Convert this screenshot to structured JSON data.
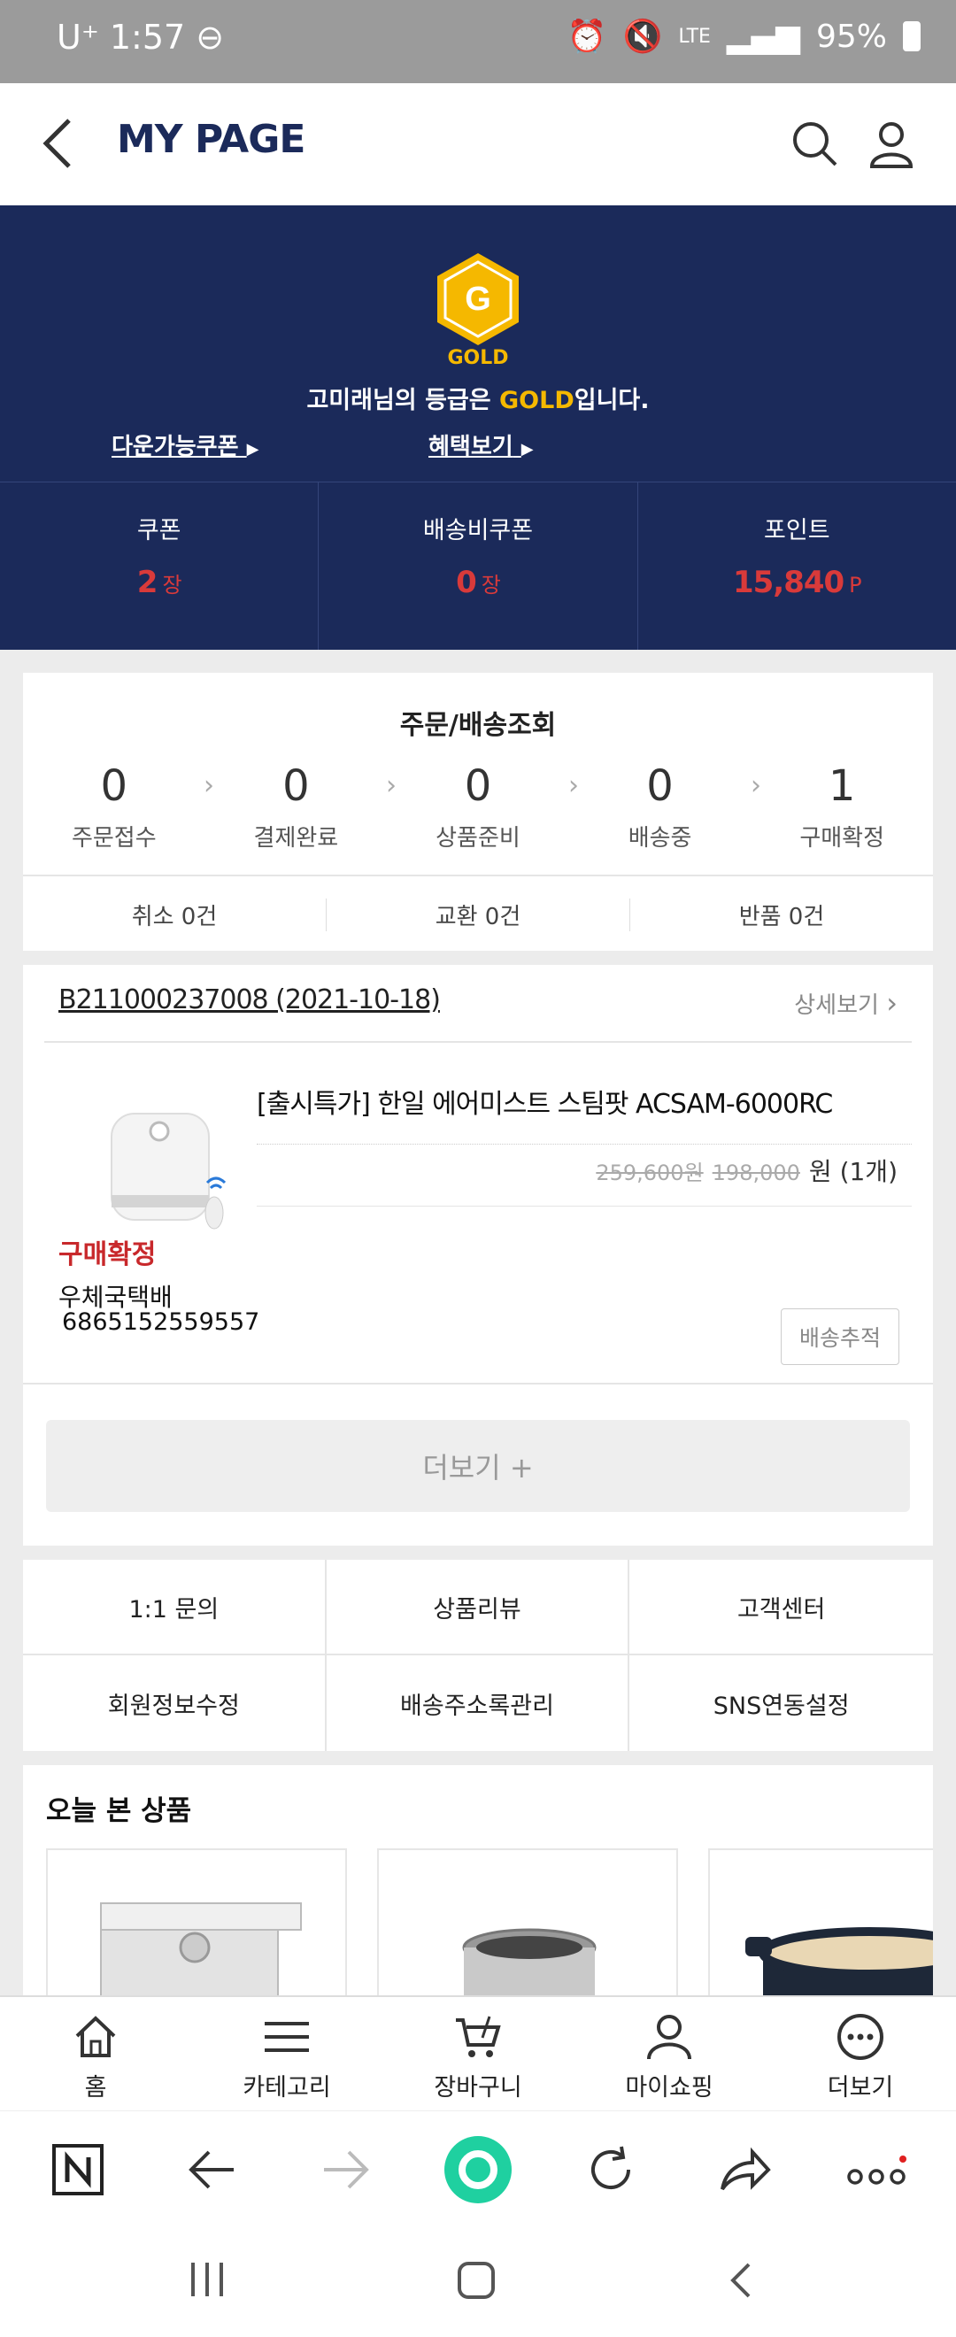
{
  "status": {
    "carrier": "U⁺",
    "time": "1:57",
    "network": "LTE",
    "battery": "95%"
  },
  "header": {
    "title": "MY PAGE"
  },
  "grade": {
    "badge_letter": "G",
    "badge_word": "GOLD",
    "msg_pre": "고미래님의 등급은 ",
    "msg_grade": "GOLD",
    "msg_post": "입니다.",
    "link_coupons": "다운가능쿠폰",
    "link_benefits": "혜택보기"
  },
  "stats": [
    {
      "label": "쿠폰",
      "value": "2",
      "unit": "장"
    },
    {
      "label": "배송비쿠폰",
      "value": "0",
      "unit": "장"
    },
    {
      "label": "포인트",
      "value": "15,840",
      "unit": "P"
    }
  ],
  "orders": {
    "title": "주문/배송조회",
    "steps": [
      {
        "count": "0",
        "label": "주문접수"
      },
      {
        "count": "0",
        "label": "결제완료"
      },
      {
        "count": "0",
        "label": "상품준비"
      },
      {
        "count": "0",
        "label": "배송중"
      },
      {
        "count": "1",
        "label": "구매확정"
      }
    ],
    "sub": [
      "취소 0건",
      "교환 0건",
      "반품 0건"
    ]
  },
  "order_detail": {
    "order_no": "B211000237008 (2021-10-18)",
    "detail_link": "상세보기",
    "product_name": "[출시특가] 한일 에어미스트 스팀팟 ACSAM-6000RC",
    "price_original": "259,600원",
    "price_sale": "198,000",
    "price_suffix": "원 (1개)",
    "status": "구매확정",
    "courier": "우체국택배",
    "tracking_no": "6865152559557",
    "track_button": "배송추적",
    "more_button": "더보기 +"
  },
  "menu": [
    "1:1 문의",
    "상품리뷰",
    "고객센터",
    "회원정보수정",
    "배송주소록관리",
    "SNS연동설정"
  ],
  "recent": {
    "title": "오늘 본 상품"
  },
  "bottom_nav": [
    "홈",
    "카테고리",
    "장바구니",
    "마이쇼핑",
    "더보기"
  ],
  "colors": {
    "navy": "#1b2a5a",
    "gold": "#f5b800",
    "red": "#d93a3a"
  }
}
